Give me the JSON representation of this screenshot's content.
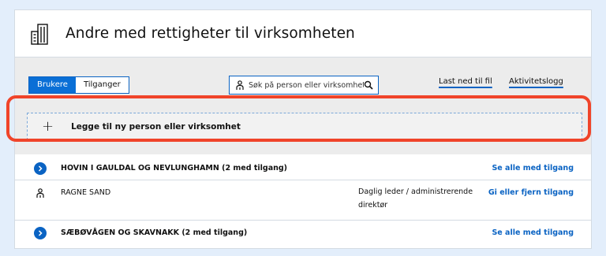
{
  "header": {
    "title": "Andre med rettigheter til virksomheten",
    "icon": "building-icon"
  },
  "toolbar": {
    "tabs": [
      {
        "label": "Brukere",
        "active": true
      },
      {
        "label": "Tilganger",
        "active": false
      }
    ],
    "search": {
      "placeholder": "Søk på person eller virksomhet"
    },
    "download_label": "Last ned til fil",
    "activity_label": "Aktivitetslogg"
  },
  "add_row": {
    "label": "Legge til ny person eller virksomhet"
  },
  "list": [
    {
      "type": "org",
      "name": "HOVIN I GAULDAL OG NEVLUNGHAMN (2 med tilgang)",
      "action": "Se alle med tilgang"
    },
    {
      "type": "person",
      "name": "RAGNE SAND",
      "role": "Daglig leder / administrerende direktør",
      "action": "Gi eller fjern tilgang"
    },
    {
      "type": "org",
      "name": "SÆBØVÅGEN OG SKAVNAKK (2 med tilgang)",
      "action": "Se alle med tilgang"
    }
  ],
  "colors": {
    "accent": "#0a63c3",
    "highlight": "#f0442a",
    "background": "#e3eefb"
  }
}
